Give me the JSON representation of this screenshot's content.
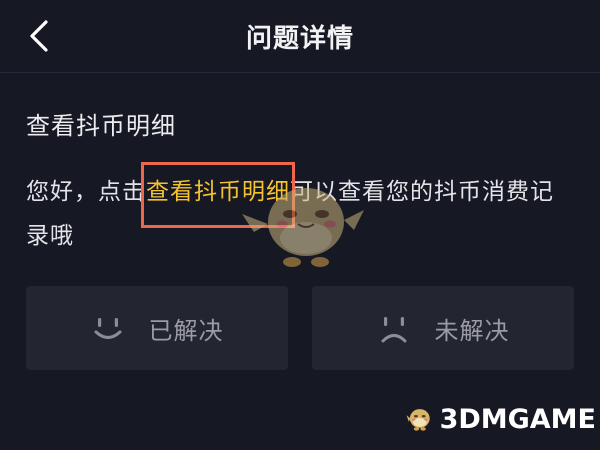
{
  "nav": {
    "title": "问题详情",
    "back_icon": "chevron-left-icon"
  },
  "question": {
    "title": "查看抖币明细"
  },
  "answer": {
    "prefix": "您好，点击",
    "link_text": "查看抖币明细",
    "suffix": "可以查看您的抖币消费记录哦"
  },
  "feedback": {
    "resolved": {
      "label": "已解决",
      "icon": "smile-icon"
    },
    "unresolved": {
      "label": "未解决",
      "icon": "sad-face-icon"
    }
  },
  "watermark": {
    "text": "3DMGAME",
    "icon": "mascot-logo-icon"
  },
  "colors": {
    "background": "#161823",
    "link": "#f5c330",
    "highlight_border": "#f0664a",
    "button_bg": "#232531",
    "button_text": "#9a9ba6"
  }
}
